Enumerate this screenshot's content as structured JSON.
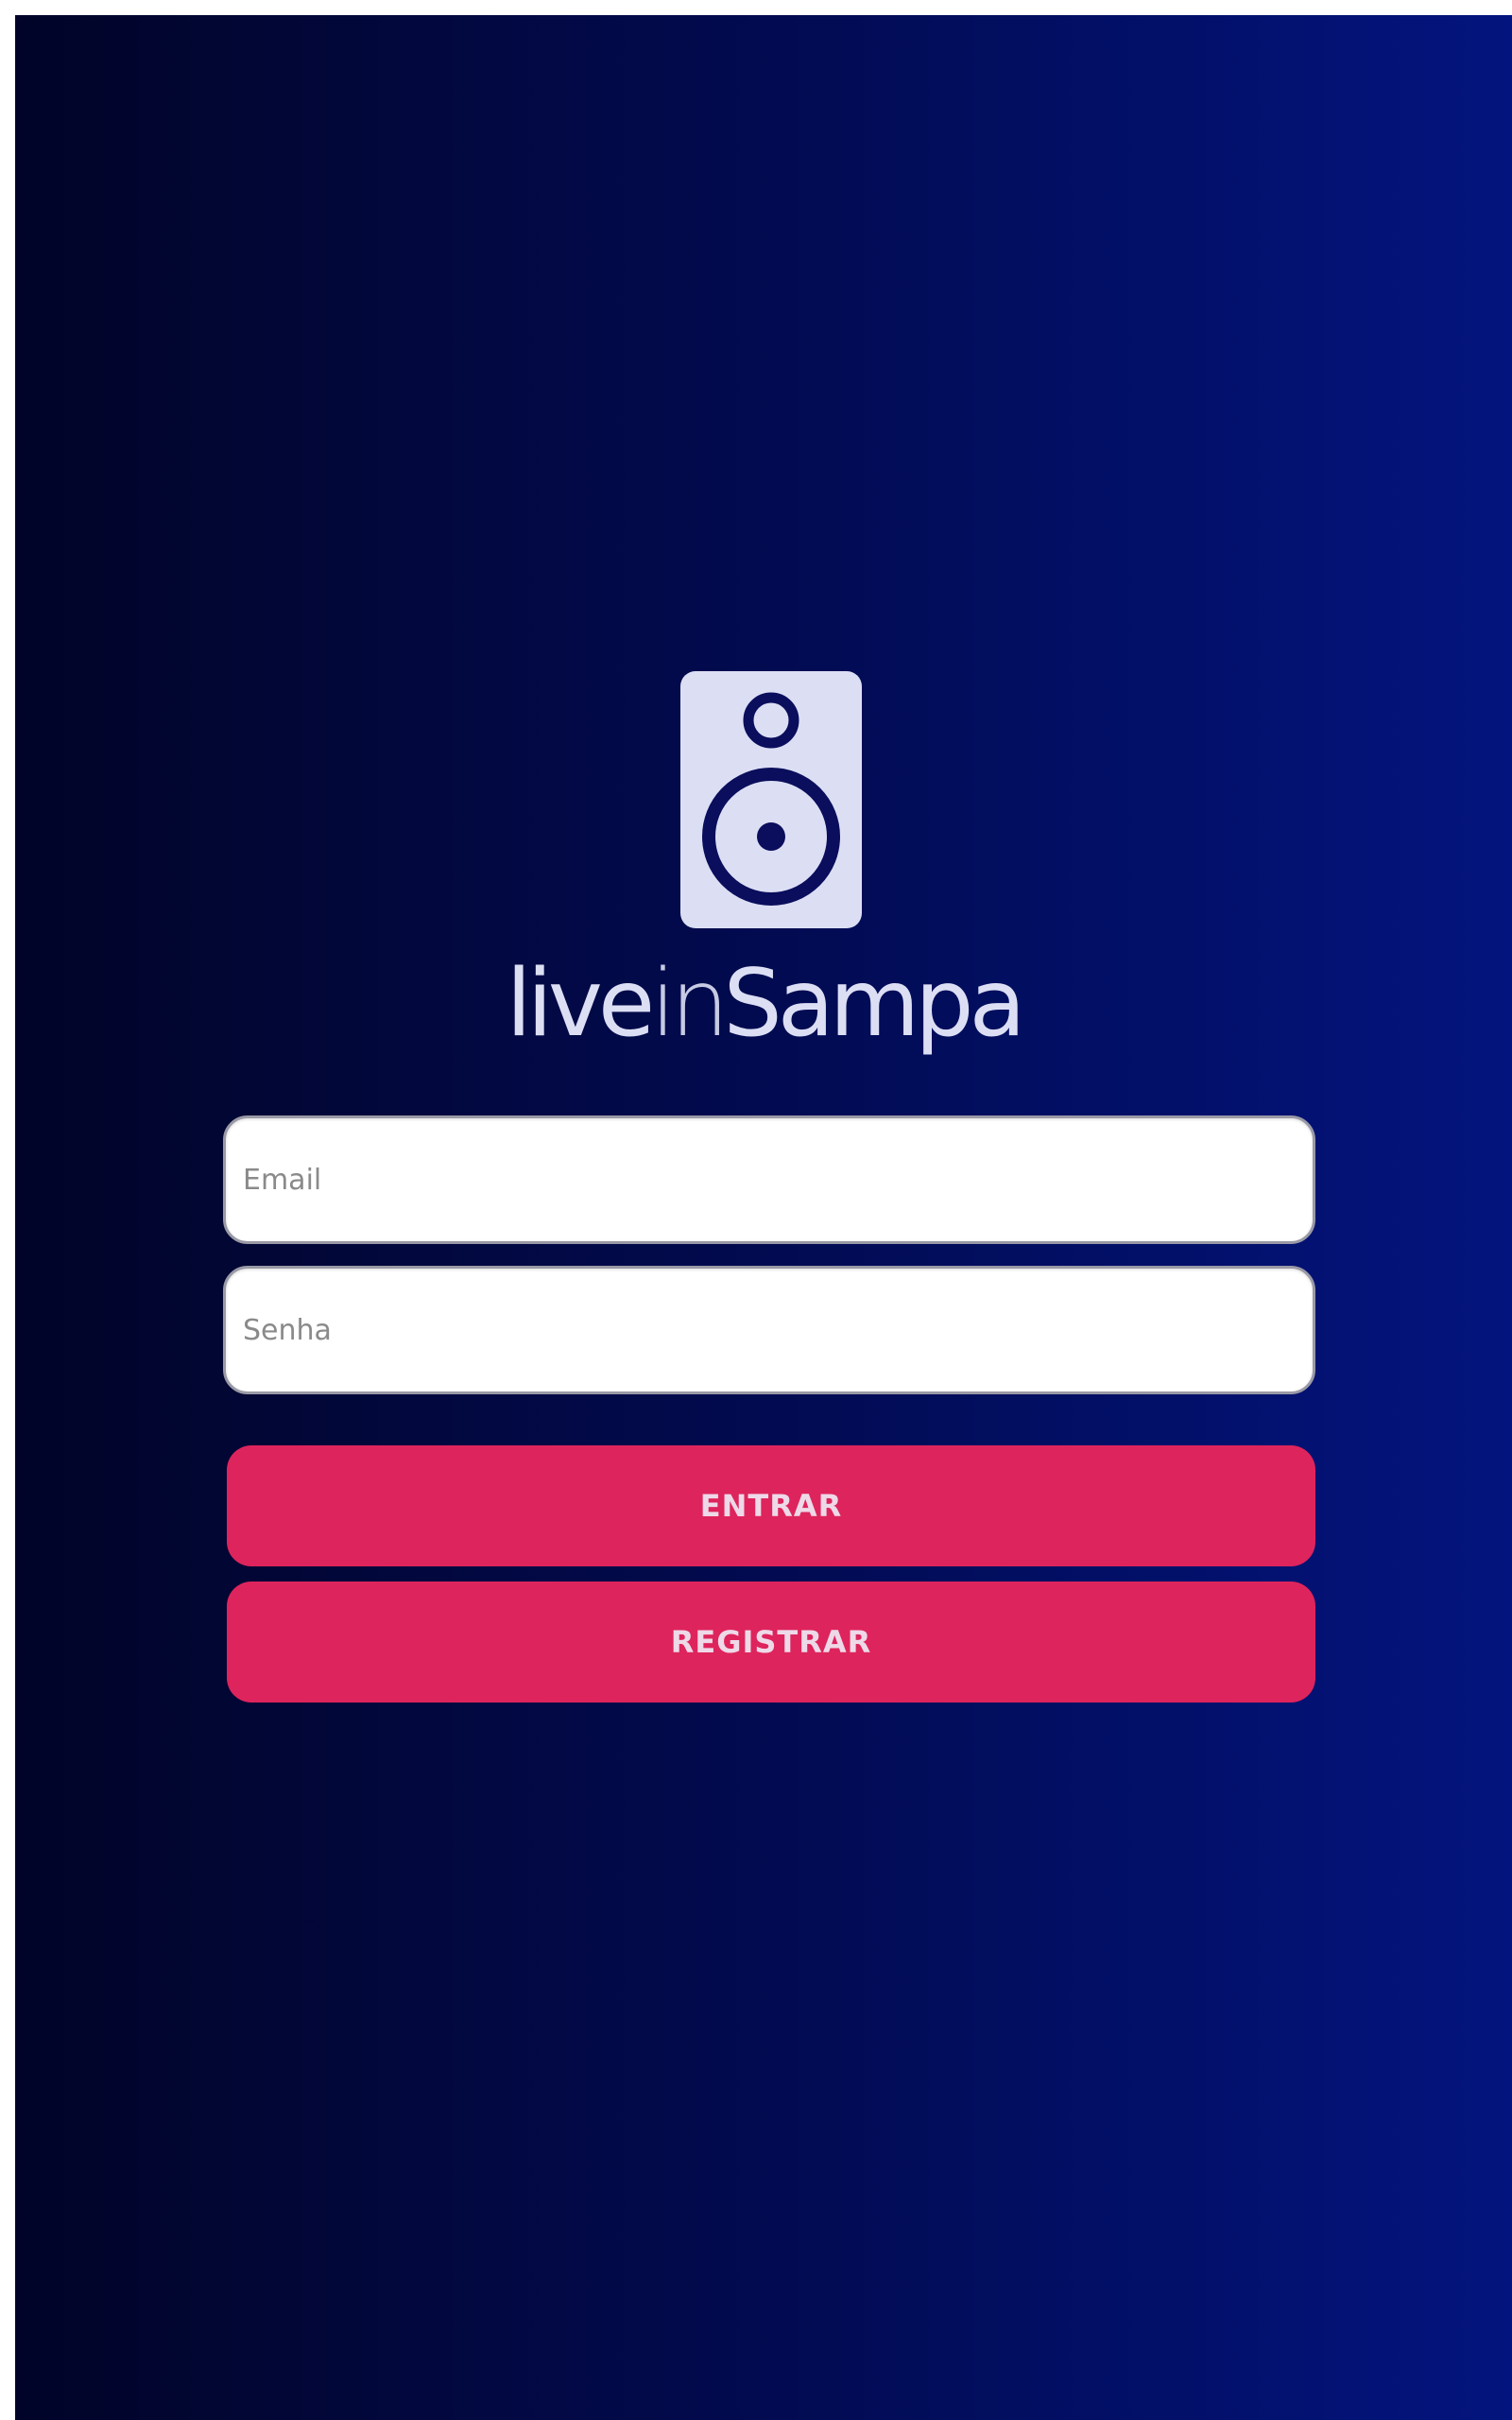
{
  "brand": {
    "wordmark_bold": "live",
    "wordmark_light": "in",
    "wordmark_end": "Sampa",
    "logo_icon": "speaker-icon",
    "logo_color": "#dcdff4"
  },
  "login": {
    "email_placeholder": "Email",
    "password_placeholder": "Senha",
    "enter_label": "ENTRAR",
    "register_label": "REGISTRAR"
  },
  "colors": {
    "background_left": "#010428",
    "background_right": "#03147e",
    "button": "#de245c",
    "button_text": "#eed9e8"
  }
}
